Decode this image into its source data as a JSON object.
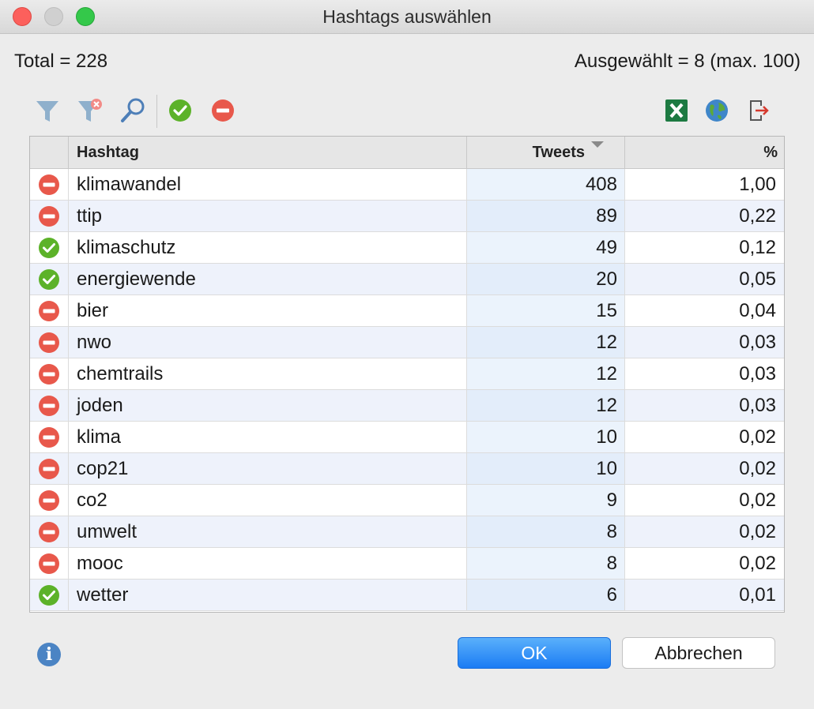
{
  "window": {
    "title": "Hashtags auswählen"
  },
  "summary": {
    "total": "Total = 228",
    "selected": "Ausgewählt = 8 (max. 100)"
  },
  "toolbar": {
    "icons": [
      "filter-icon",
      "clear-filter-icon",
      "search-icon",
      "select-all-icon",
      "deselect-all-icon",
      "excel-export-icon",
      "globe-icon",
      "export-icon"
    ],
    "colors": {
      "green": "#5cb229",
      "red": "#e8584b",
      "filter": "#8fb0cc",
      "excel": "#1d7a42"
    }
  },
  "table": {
    "headers": {
      "icon": "",
      "hashtag": "Hashtag",
      "tweets": "Tweets",
      "percent": "%"
    },
    "sort": {
      "column": "tweets",
      "direction": "descending"
    },
    "rows": [
      {
        "status": "excluded",
        "hashtag": "klimawandel",
        "tweets": "408",
        "percent": "1,00"
      },
      {
        "status": "excluded",
        "hashtag": "ttip",
        "tweets": "89",
        "percent": "0,22"
      },
      {
        "status": "selected",
        "hashtag": "klimaschutz",
        "tweets": "49",
        "percent": "0,12"
      },
      {
        "status": "selected",
        "hashtag": "energiewende",
        "tweets": "20",
        "percent": "0,05"
      },
      {
        "status": "excluded",
        "hashtag": "bier",
        "tweets": "15",
        "percent": "0,04"
      },
      {
        "status": "excluded",
        "hashtag": "nwo",
        "tweets": "12",
        "percent": "0,03"
      },
      {
        "status": "excluded",
        "hashtag": "chemtrails",
        "tweets": "12",
        "percent": "0,03"
      },
      {
        "status": "excluded",
        "hashtag": "joden",
        "tweets": "12",
        "percent": "0,03"
      },
      {
        "status": "excluded",
        "hashtag": "klima",
        "tweets": "10",
        "percent": "0,02"
      },
      {
        "status": "excluded",
        "hashtag": "cop21",
        "tweets": "10",
        "percent": "0,02"
      },
      {
        "status": "excluded",
        "hashtag": "co2",
        "tweets": "9",
        "percent": "0,02"
      },
      {
        "status": "excluded",
        "hashtag": "umwelt",
        "tweets": "8",
        "percent": "0,02"
      },
      {
        "status": "excluded",
        "hashtag": "mooc",
        "tweets": "8",
        "percent": "0,02"
      },
      {
        "status": "selected",
        "hashtag": "wetter",
        "tweets": "6",
        "percent": "0,01"
      }
    ]
  },
  "footer": {
    "info_icon": "info-icon",
    "ok_label": "OK",
    "cancel_label": "Abbrechen"
  }
}
